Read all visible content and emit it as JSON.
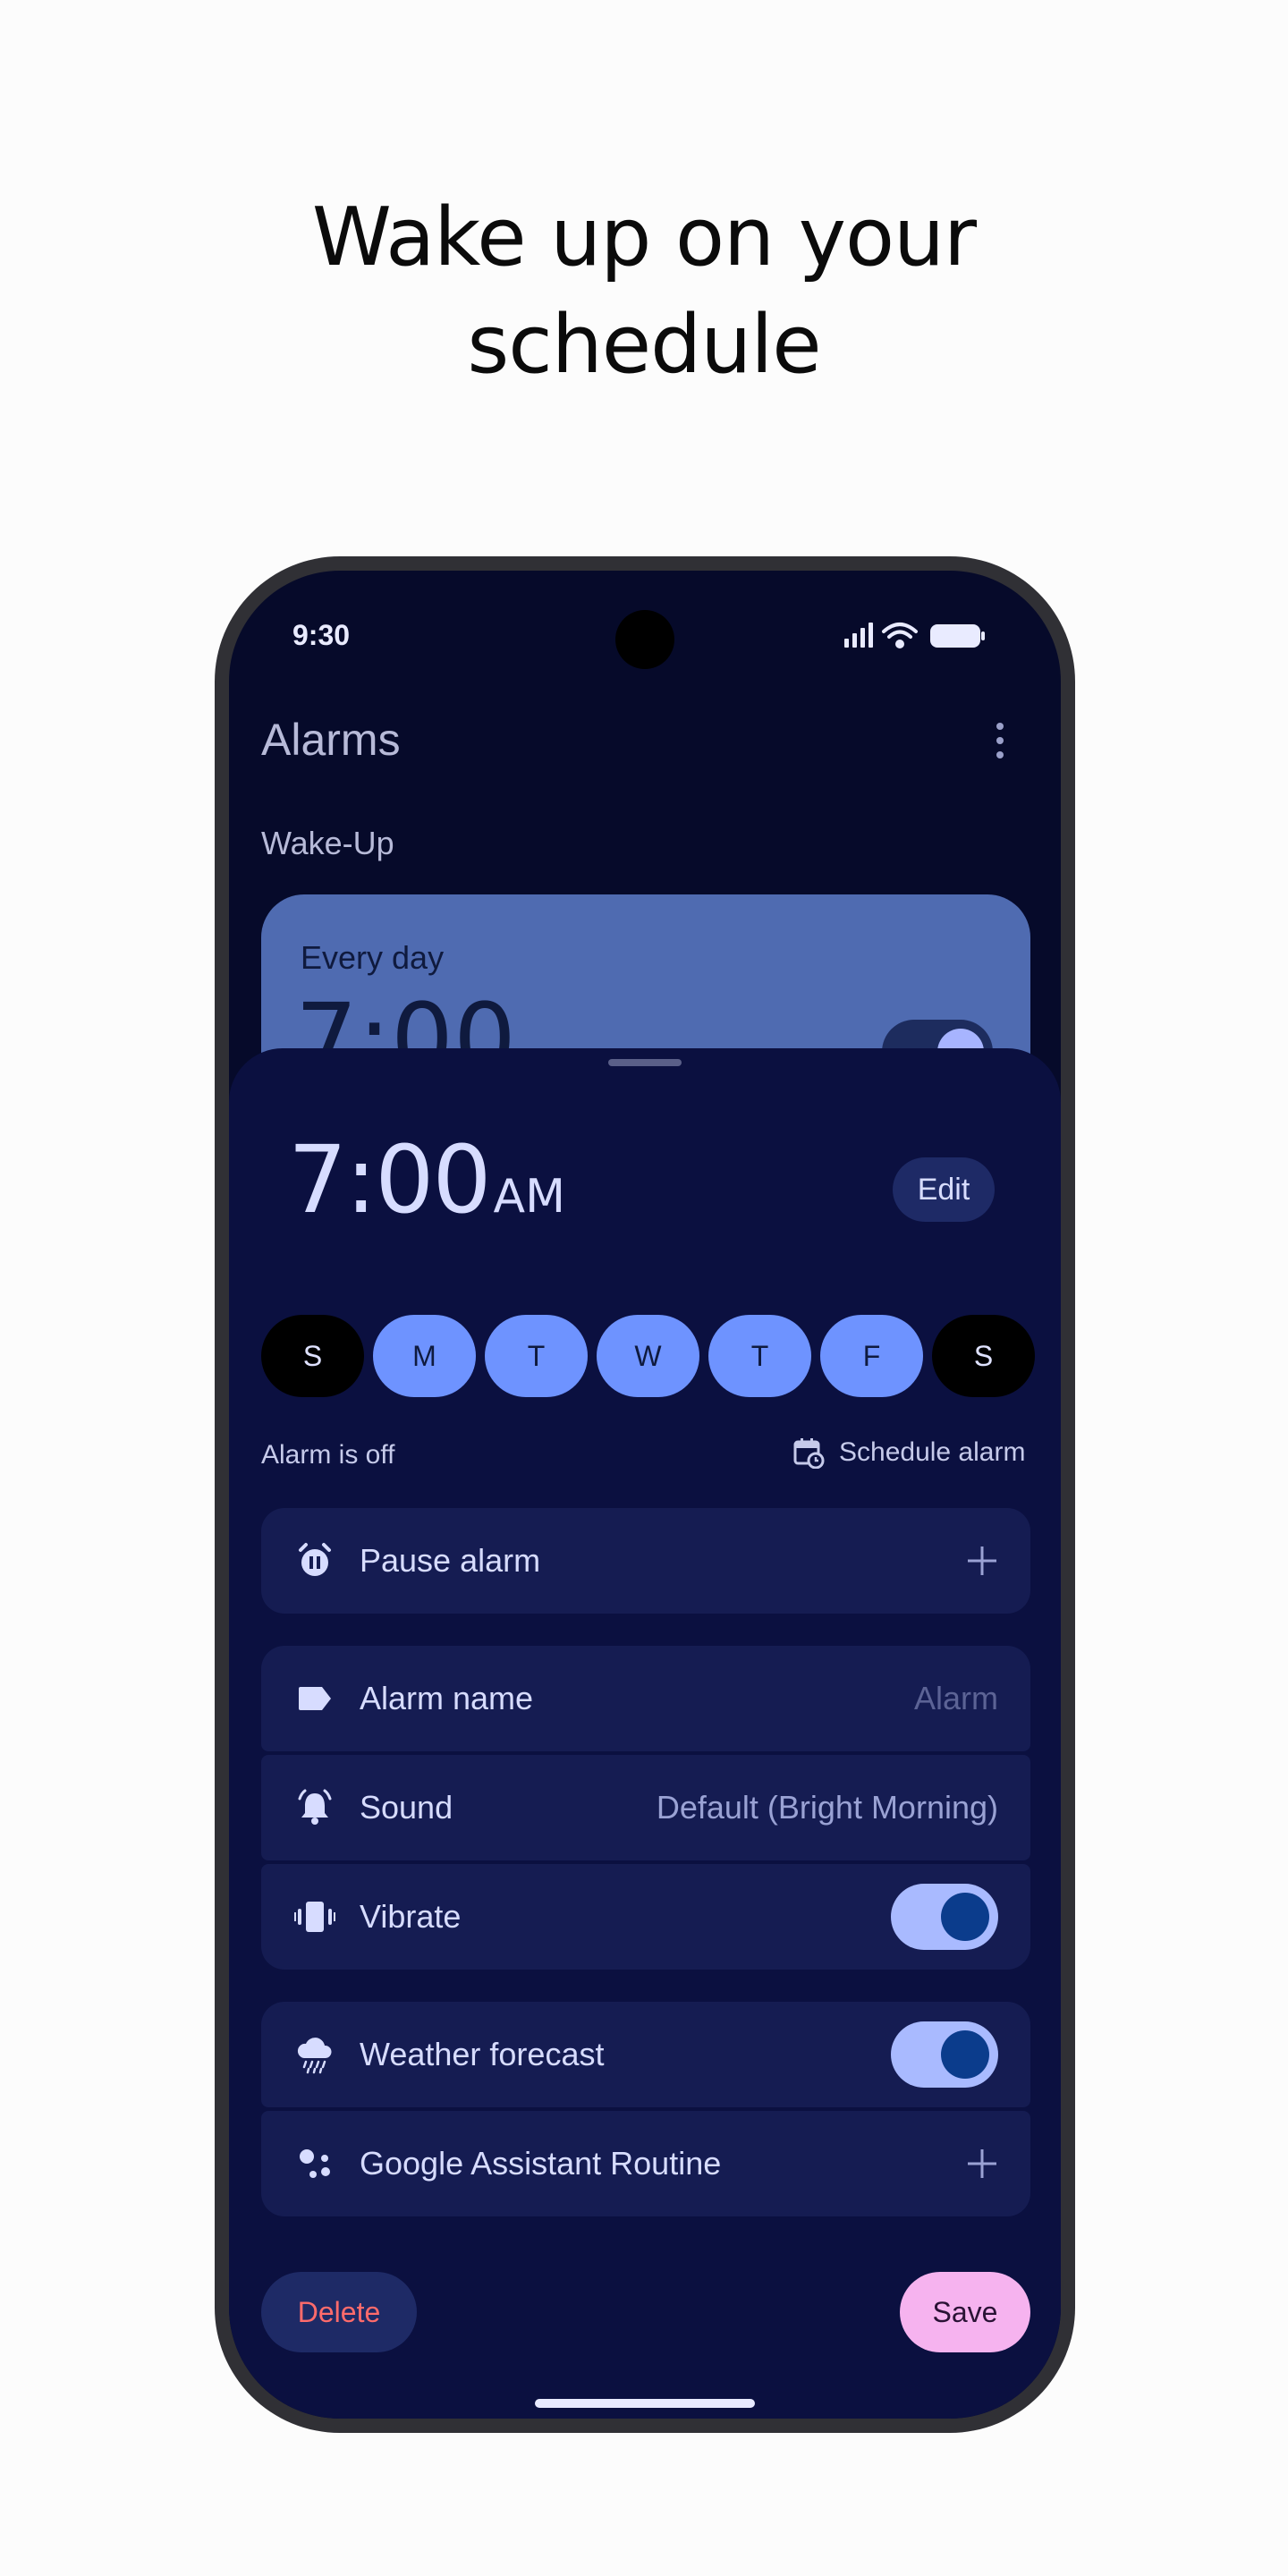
{
  "headline": {
    "line1": "Wake up on your",
    "line2": "schedule"
  },
  "status_bar": {
    "time": "9:30",
    "icons": [
      "signal-icon",
      "wifi-icon",
      "battery-icon"
    ]
  },
  "app": {
    "title": "Alarms",
    "menu_icon": "more-vert-icon"
  },
  "section": {
    "title": "Wake-Up"
  },
  "alarm_card": {
    "days": "Every day",
    "time": "7:00",
    "enabled": true
  },
  "editor": {
    "time": "7:00",
    "ampm": "AM",
    "edit_label": "Edit",
    "days": [
      {
        "letter": "S",
        "selected": false
      },
      {
        "letter": "M",
        "selected": true
      },
      {
        "letter": "T",
        "selected": true
      },
      {
        "letter": "W",
        "selected": true
      },
      {
        "letter": "T",
        "selected": true
      },
      {
        "letter": "F",
        "selected": true
      },
      {
        "letter": "S",
        "selected": false
      }
    ],
    "alarm_state": "Alarm is off",
    "schedule_label": "Schedule alarm",
    "rows": {
      "pause": {
        "label": "Pause alarm",
        "icon": "alarm-pause-icon",
        "action_icon": "plus-icon"
      },
      "name": {
        "label": "Alarm name",
        "value": "Alarm",
        "icon": "label-icon"
      },
      "sound": {
        "label": "Sound",
        "value": "Default (Bright Morning)",
        "icon": "bell-icon"
      },
      "vibrate": {
        "label": "Vibrate",
        "enabled": true,
        "icon": "vibrate-icon"
      },
      "weather": {
        "label": "Weather forecast",
        "enabled": true,
        "icon": "rain-cloud-icon"
      },
      "assistant": {
        "label": "Google Assistant Routine",
        "icon": "assistant-icon",
        "action_icon": "plus-icon"
      }
    },
    "delete_label": "Delete",
    "save_label": "Save"
  },
  "colors": {
    "background": "#fcfcfc",
    "screen": "#060a2a",
    "sheet": "#0b1040",
    "row": "#151c52",
    "accent_day": "#6e93ff",
    "save": "#f6b3ef",
    "delete_text": "#ff6b6b"
  }
}
